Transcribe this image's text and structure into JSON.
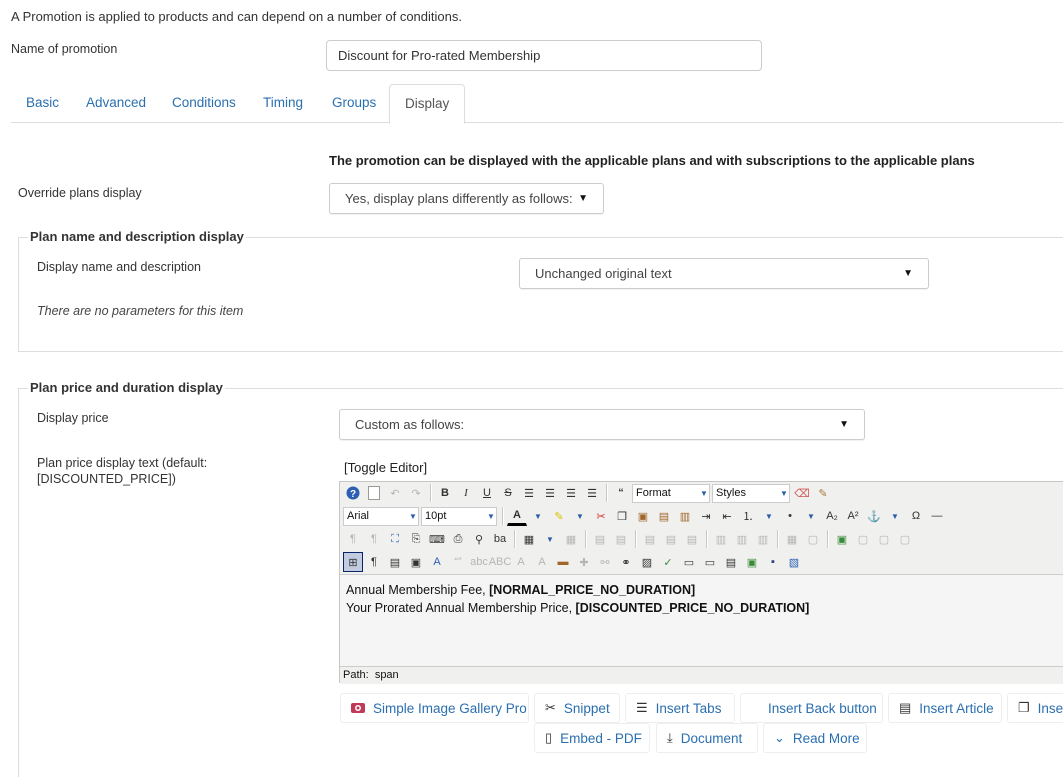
{
  "intro_text": "A Promotion is applied to products and can depend on a number of conditions.",
  "name_field": {
    "label": "Name of promotion",
    "value": "Discount for Pro-rated Membership"
  },
  "tabs": [
    {
      "label": "Basic"
    },
    {
      "label": "Advanced"
    },
    {
      "label": "Conditions"
    },
    {
      "label": "Timing"
    },
    {
      "label": "Groups"
    },
    {
      "label": "Display",
      "active": true
    }
  ],
  "display": {
    "heading": "The promotion can be displayed with the applicable plans and with subscriptions to the applicable plans",
    "override_label": "Override plans display",
    "override_value": "Yes, display plans differently as follows:"
  },
  "plan_name_section": {
    "legend": "Plan name and description display",
    "field_label": "Display name and description",
    "field_value": "Unchanged original text",
    "note": "There are no parameters for this item"
  },
  "plan_price_section": {
    "legend": "Plan price and duration display",
    "price_label": "Display price",
    "price_value": "Custom as follows:",
    "text_label_line1": "Plan price display text (default:",
    "text_label_line2": "[DISCOUNTED_PRICE])",
    "toggle_editor": "[Toggle Editor]"
  },
  "editor": {
    "format_select": "Format",
    "styles_select": "Styles",
    "font_select": "Arial",
    "size_select": "10pt",
    "line1_text": "Annual Membership Fee, ",
    "line1_tag": "[NORMAL_PRICE_NO_DURATION]",
    "line2_text": "Your Prorated Annual Membership Price, ",
    "line2_tag": "[DISCOUNTED_PRICE_NO_DURATION]",
    "path_label": "Path:",
    "path_value": "span"
  },
  "extension_buttons": [
    {
      "label": "Simple Image Gallery Pro",
      "icon": "camera-icon"
    },
    {
      "label": "Snippet",
      "icon": "scissors-icon"
    },
    {
      "label": "Insert Tabs",
      "icon": "list-icon"
    },
    {
      "label": "Insert Back button",
      "icon": ""
    },
    {
      "label": "Insert Article",
      "icon": "article-icon"
    },
    {
      "label": "Inse",
      "icon": "copy-icon"
    },
    {
      "label": "Embed - PDF",
      "icon": "file-icon"
    },
    {
      "label": "Document",
      "icon": "download-icon"
    },
    {
      "label": "Read More",
      "icon": "chevron-down-icon"
    }
  ],
  "colors": {
    "link": "#2a6fb0",
    "border": "#dddddd",
    "editor_bg": "#f0f0ee"
  }
}
